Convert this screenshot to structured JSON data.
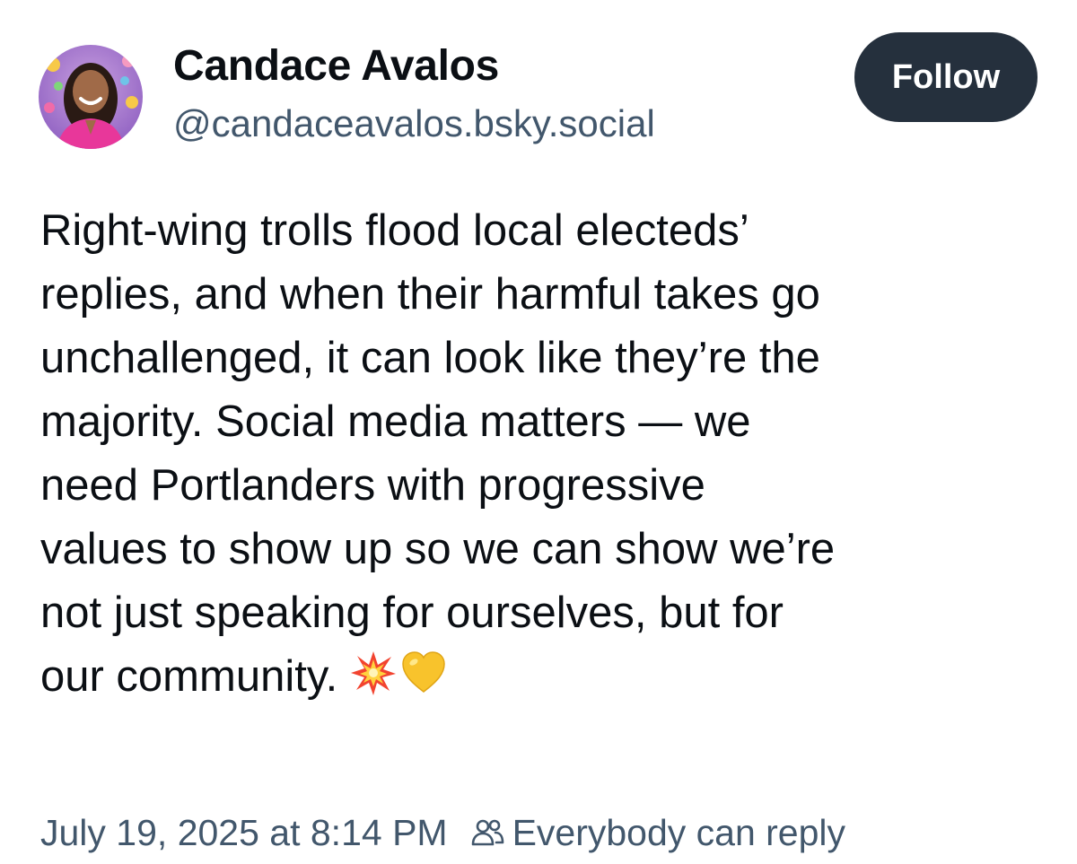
{
  "author": {
    "display_name": "Candace Avalos",
    "handle": "@candaceavalos.bsky.social",
    "avatar_icon": "profile-photo"
  },
  "follow_button": {
    "label": "Follow",
    "background": "#25303d"
  },
  "post": {
    "text": "Right-wing trolls flood local electeds’\nreplies, and when their harmful takes go\nunchallenged, it can look like they’re the\nmajority. Social media matters — we\nneed Portlanders with progressive\nvalues to show up so we can show we’re\nnot just speaking for ourselves, but for\nour community.",
    "emojis": [
      "collision-icon",
      "yellow-heart-icon"
    ]
  },
  "meta": {
    "timestamp": "July 19, 2025 at 8:14 PM",
    "reply_setting_icon": "people-icon",
    "reply_setting": "Everybody can reply"
  },
  "colors": {
    "text_primary": "#0b0f14",
    "text_secondary": "#42576c",
    "background": "#ffffff"
  }
}
